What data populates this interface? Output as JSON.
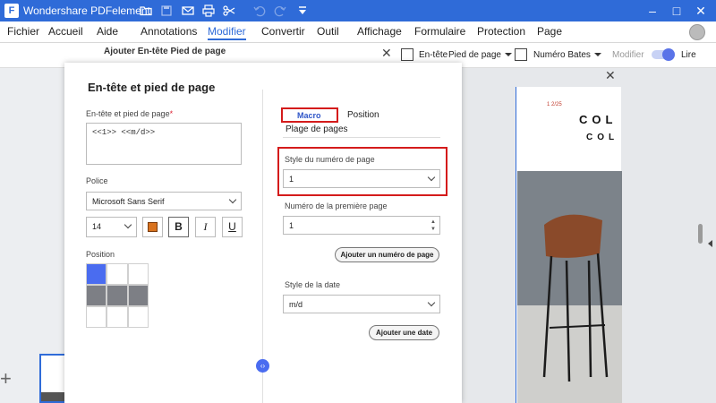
{
  "app": {
    "title": "Wondershare PDFelement",
    "logo_glyph": "F"
  },
  "menu": {
    "items": [
      "Fichier",
      "Accueil",
      "Aide",
      "Annotations",
      "Modifier",
      "Convertir",
      "Outil",
      "Affichage",
      "Formulaire",
      "Protection",
      "Page"
    ],
    "active": "Modifier"
  },
  "subbar": {
    "header_label": "En-tête",
    "footer_label": "Pied de page",
    "bates_label": "Numéro Bates",
    "modify_label": "Modifier",
    "read_label": "Lire"
  },
  "back_panel": {
    "title": "Ajouter En-tête Pied de page"
  },
  "dialog": {
    "title": "En-tête et pied de page",
    "content_label": "En-tête et pied de page",
    "required_mark": "*",
    "content_value": "<<1>> <<m/d>>",
    "font_label": "Police",
    "font_value": "Microsoft Sans Serif",
    "size_value": "14",
    "bold_glyph": "B",
    "italic_glyph": "I",
    "underline_glyph": "U",
    "position_label": "Position",
    "position_grid": {
      "rows": 3,
      "cols": 3,
      "selected": [
        0,
        0
      ],
      "filled_row": 1
    },
    "font_color": "#d9731f",
    "collapse_glyph": "‹›",
    "tabs": {
      "macro": "Macro",
      "position": "Position",
      "page_range": "Plage de pages"
    },
    "page_number_style_label": "Style du numéro de page",
    "page_number_style_value": "1",
    "first_page_number_label": "Numéro de la première page",
    "first_page_number_value": "1",
    "add_page_number_button": "Ajouter un numéro de page",
    "date_style_label": "Style de la date",
    "date_style_value": "m/d",
    "add_date_button": "Ajouter une date"
  },
  "preview": {
    "page_number_text": "1 2/25",
    "heading_line1": "COL",
    "heading_line2": "COL"
  },
  "colors": {
    "accent": "#2f6bd8",
    "highlight_red": "#d41b1b",
    "selected_cell": "#4a6cf0"
  }
}
